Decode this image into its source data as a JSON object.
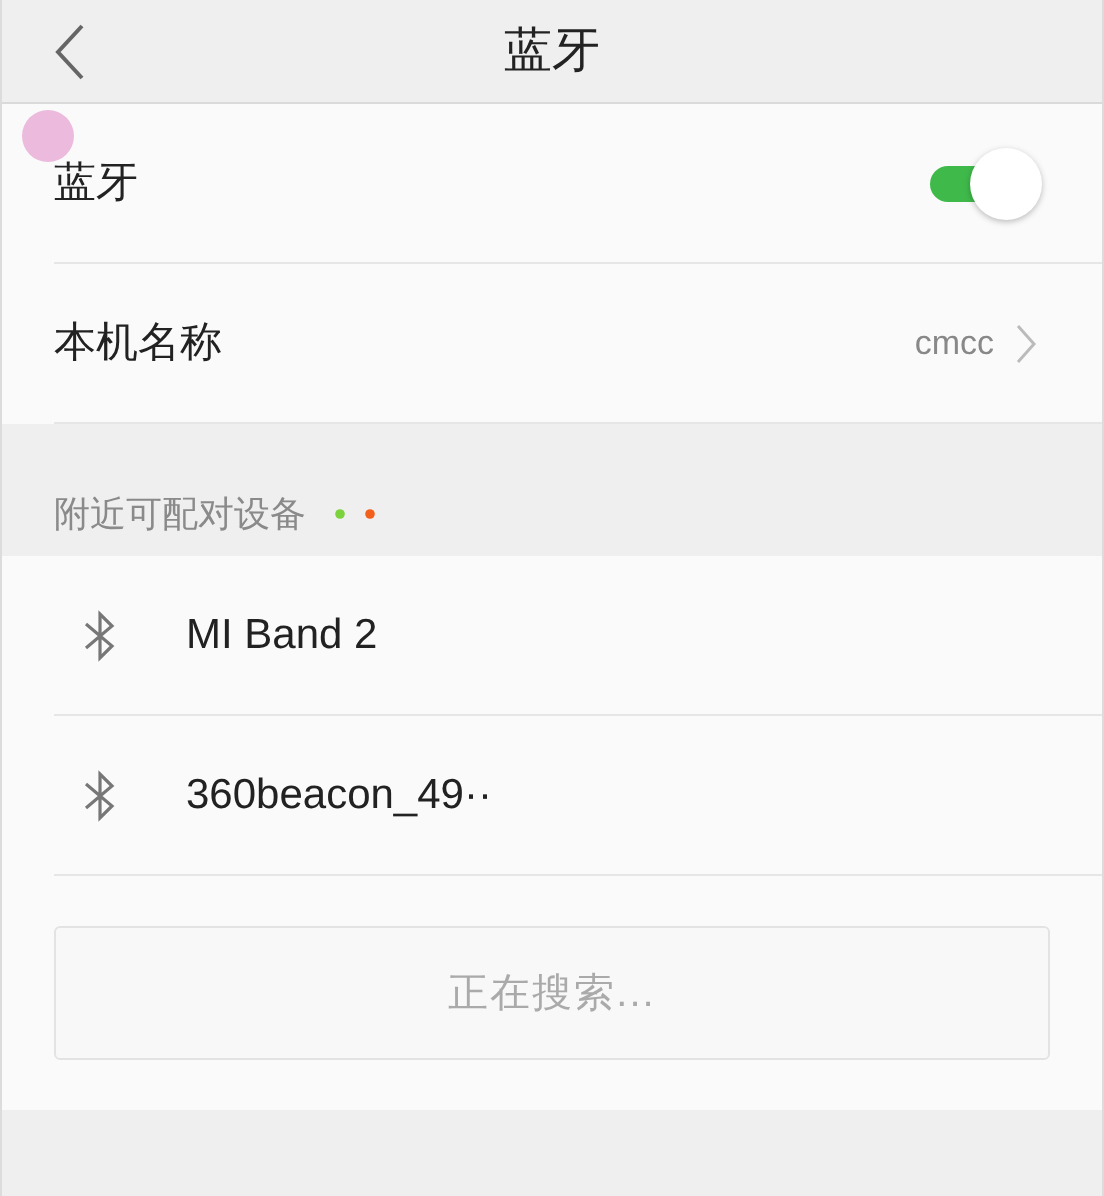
{
  "header": {
    "title": "蓝牙"
  },
  "settings": [
    {
      "kind": "toggle",
      "label": "蓝牙",
      "on": true
    },
    {
      "kind": "link",
      "label": "本机名称",
      "value": "cmcc"
    }
  ],
  "devices_section": {
    "title": "附近可配对设备",
    "scanning": true,
    "devices": [
      {
        "name": "MI Band 2"
      },
      {
        "name": "360beacon_49··"
      }
    ],
    "status": "正在搜索..."
  }
}
